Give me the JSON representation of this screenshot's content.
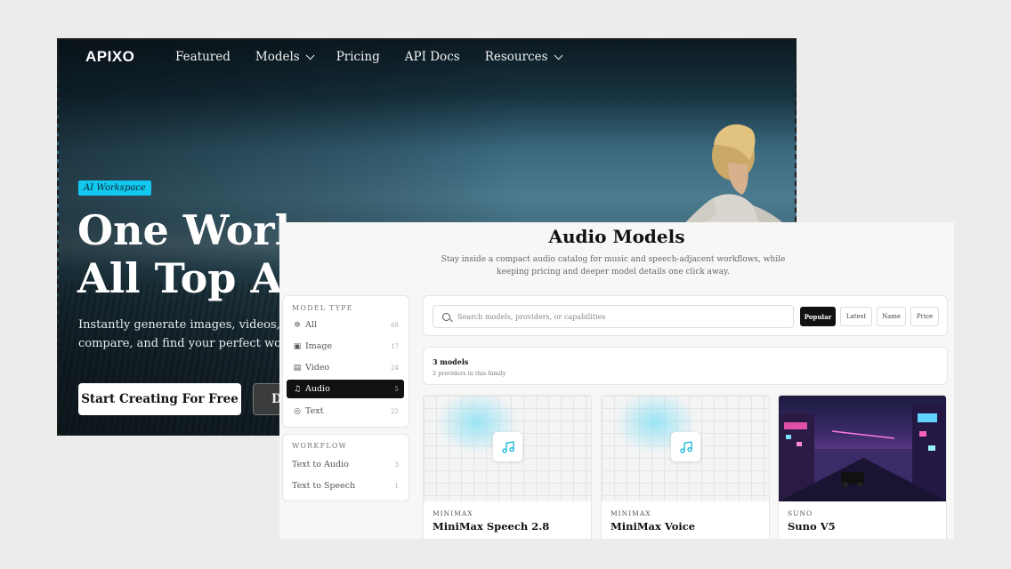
{
  "hero": {
    "logo": "APIXO",
    "nav": [
      {
        "label": "Featured",
        "dropdown": false
      },
      {
        "label": "Models",
        "dropdown": true
      },
      {
        "label": "Pricing",
        "dropdown": false
      },
      {
        "label": "API Docs",
        "dropdown": false
      },
      {
        "label": "Resources",
        "dropdown": true
      }
    ],
    "badge": "AI Workspace",
    "headline_line1": "One Work",
    "headline_line2": "All Top AI",
    "sub_line1": "Instantly generate images, videos, music ,",
    "sub_line2": "compare, and find your perfect workflow",
    "cta_primary": "Start Creating For Free",
    "cta_secondary": "D",
    "accent_color": "#13c8f0"
  },
  "catalog": {
    "title": "Audio Models",
    "subtitle": "Stay inside a compact audio catalog for music and speech-adjacent workflows, while keeping pricing and deeper model details one click away.",
    "model_type_heading": "MODEL TYPE",
    "model_types": [
      {
        "label": "All",
        "count": "68",
        "icon": "sparkle-icon",
        "glyph": "✲",
        "active": false
      },
      {
        "label": "Image",
        "count": "17",
        "icon": "image-icon",
        "glyph": "▣",
        "active": false
      },
      {
        "label": "Video",
        "count": "24",
        "icon": "video-icon",
        "glyph": "▤",
        "active": false
      },
      {
        "label": "Audio",
        "count": "5",
        "icon": "music-note-icon",
        "glyph": "♫",
        "active": true
      },
      {
        "label": "Text",
        "count": "22",
        "icon": "text-icon",
        "glyph": "◎",
        "active": false
      }
    ],
    "workflow_heading": "WORKFLOW",
    "workflows": [
      {
        "label": "Text to Audio",
        "count": "3"
      },
      {
        "label": "Text to Speech",
        "count": "1"
      }
    ],
    "search_placeholder": "Search models, providers, or capabilities",
    "sort_options": [
      "Popular",
      "Latest",
      "Name",
      "Price"
    ],
    "sort_active": "Popular",
    "result_count": "3 models",
    "result_sub": "2 providers in this family",
    "models": [
      {
        "provider": "MINIMAX",
        "name": "MiniMax Speech 2.8",
        "thumb": "music-note-icon"
      },
      {
        "provider": "MINIMAX",
        "name": "MiniMax Voice",
        "thumb": "music-note-icon"
      },
      {
        "provider": "SUNO",
        "name": "Suno V5",
        "thumb": "neon-city-image"
      }
    ]
  }
}
